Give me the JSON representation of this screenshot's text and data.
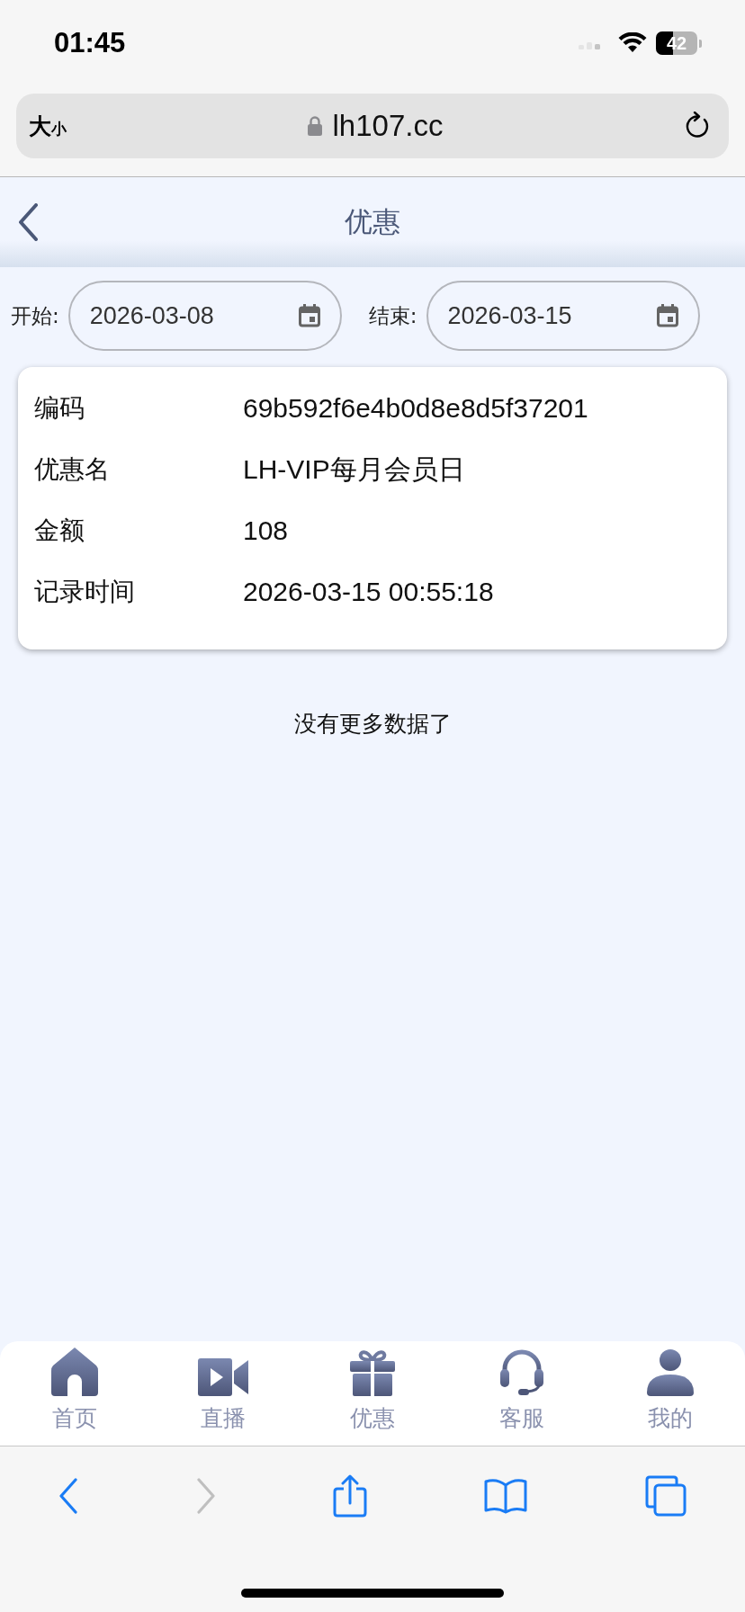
{
  "status_bar": {
    "time": "01:45",
    "battery": "42"
  },
  "address_bar": {
    "text_size": {
      "large": "大",
      "small": "小"
    },
    "url": "lh107.cc"
  },
  "header": {
    "title": "优惠"
  },
  "filters": [
    {
      "label": "开始:",
      "value": "2026-03-08"
    },
    {
      "label": "结束:",
      "value": "2026-03-15"
    }
  ],
  "records": [
    {
      "fields": [
        {
          "label": "编码",
          "value": "69b592f6e4b0d8e8d5f37201"
        },
        {
          "label": "优惠名",
          "value": "LH-VIP每月会员日"
        },
        {
          "label": "金额",
          "value": "108"
        },
        {
          "label": "记录时间",
          "value": "2026-03-15 00:55:18"
        }
      ]
    }
  ],
  "end_message": "没有更多数据了",
  "tab_bar": [
    {
      "kind": "home",
      "label": "首页"
    },
    {
      "kind": "live",
      "label": "直播"
    },
    {
      "kind": "gift",
      "label": "优惠"
    },
    {
      "kind": "support",
      "label": "客服"
    },
    {
      "kind": "profile",
      "label": "我的"
    }
  ],
  "browser_toolbar": [
    {
      "kind": "back",
      "disabled": false
    },
    {
      "kind": "forward",
      "disabled": true
    },
    {
      "kind": "share",
      "disabled": false
    },
    {
      "kind": "bookmarks",
      "disabled": false
    },
    {
      "kind": "tabs",
      "disabled": false
    }
  ]
}
